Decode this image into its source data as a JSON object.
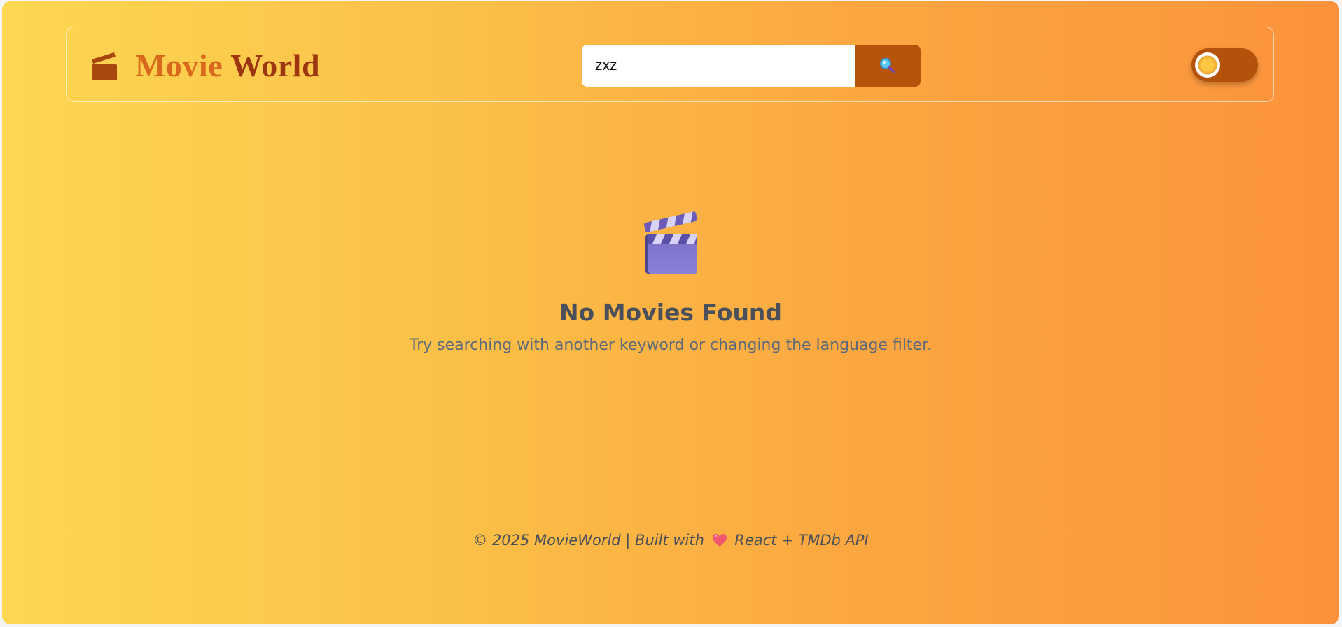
{
  "header": {
    "brand_word1": "Movie",
    "brand_word2": "World",
    "brand_icon": "clapperboard-icon"
  },
  "search": {
    "value": "zxz",
    "placeholder": "",
    "button_icon": "magnifier-icon"
  },
  "theme_toggle": {
    "icon": "sun-icon"
  },
  "empty_state": {
    "icon": "clapperboard-icon",
    "title": "No Movies Found",
    "message": "Try searching with another keyword or changing the language filter."
  },
  "footer": {
    "text_before": "© 2025 MovieWorld | Built with",
    "heart_icon": "heart-icon",
    "text_after": "React + TMDb API"
  },
  "colors": {
    "gradient_start": "#fdd752",
    "gradient_end": "#fc923c",
    "accent": "#b7540c",
    "brand_light": "#d9681c",
    "brand_dark": "#9c3510"
  }
}
